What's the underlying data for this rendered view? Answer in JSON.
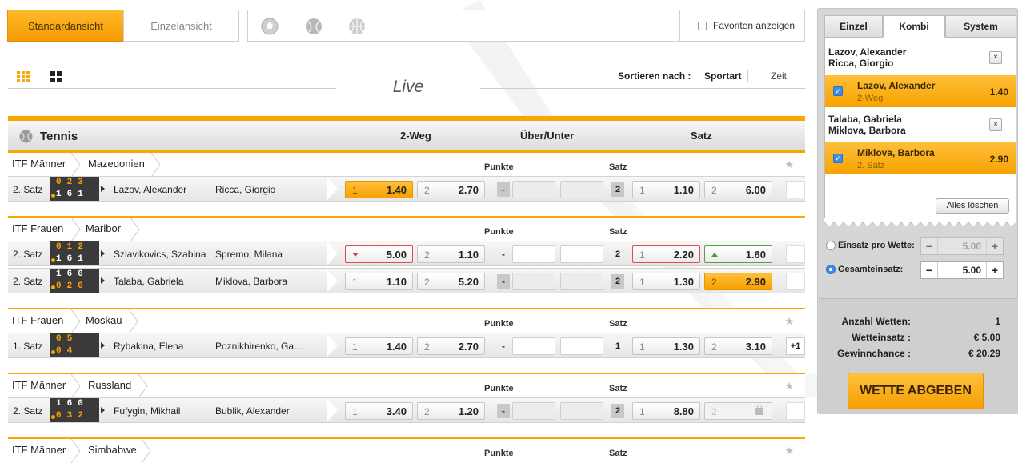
{
  "views": {
    "standard": "Standardansicht",
    "single": "Einzelansicht"
  },
  "favorites_label": "Favoriten anzeigen",
  "live_title": "Live",
  "sort": {
    "label": "Sortieren nach :",
    "sport": "Sportart",
    "time": "Zeit"
  },
  "sport": {
    "name": "Tennis",
    "col_2way": "2-Weg",
    "col_ou": "Über/Unter",
    "col_set": "Satz"
  },
  "sub_labels": {
    "points": "Punkte",
    "set": "Satz"
  },
  "leagues": [
    {
      "category": "ITF Männer",
      "event": "Mazedonien",
      "matches": [
        {
          "phase": "2. Satz",
          "score_top": "023",
          "score_bot": "161",
          "p1": "Lazov, Alexander",
          "p2": "Ricca, Giorgio",
          "o1_lbl": "1",
          "o1": "1.40",
          "o2_lbl": "2",
          "o2": "2.70",
          "dash": "-",
          "set_no": "2",
          "s1_lbl": "1",
          "s1": "1.10",
          "s2_lbl": "2",
          "s2": "6.00",
          "more": ""
        }
      ]
    },
    {
      "category": "ITF Frauen",
      "event": "Maribor",
      "matches": [
        {
          "phase": "2. Satz",
          "score_top": "012",
          "score_bot": "161",
          "p1": "Szlavikovics, Szabina",
          "p2": "Spremo, Milana",
          "o1_lbl": "",
          "o1": "5.00",
          "o2_lbl": "2",
          "o2": "1.10",
          "dash": "-",
          "set_no": "2",
          "s1_lbl": "1",
          "s1": "2.20",
          "s2_lbl": "",
          "s2": "1.60",
          "more": ""
        },
        {
          "phase": "2. Satz",
          "score_top": "160",
          "score_bot": "020",
          "p1": "Talaba, Gabriela",
          "p2": "Miklova, Barbora",
          "o1_lbl": "1",
          "o1": "1.10",
          "o2_lbl": "2",
          "o2": "5.20",
          "dash": "-",
          "set_no": "2",
          "s1_lbl": "1",
          "s1": "1.30",
          "s2_lbl": "2",
          "s2": "2.90",
          "more": ""
        }
      ]
    },
    {
      "category": "ITF Frauen",
      "event": "Moskau",
      "matches": [
        {
          "phase": "1. Satz",
          "score_top": "05",
          "score_bot": "04",
          "p1": "Rybakina, Elena",
          "p2": "Poznikhirenko, Ga…",
          "o1_lbl": "1",
          "o1": "1.40",
          "o2_lbl": "2",
          "o2": "2.70",
          "dash": "-",
          "set_no": "1",
          "s1_lbl": "1",
          "s1": "1.30",
          "s2_lbl": "2",
          "s2": "3.10",
          "more": "+1"
        }
      ]
    },
    {
      "category": "ITF Männer",
      "event": "Russland",
      "matches": [
        {
          "phase": "2. Satz",
          "score_top": "160",
          "score_bot": "032",
          "p1": "Fufygin, Mikhail",
          "p2": "Bublik, Alexander",
          "o1_lbl": "1",
          "o1": "3.40",
          "o2_lbl": "2",
          "o2": "1.20",
          "dash": "-",
          "set_no": "2",
          "s1_lbl": "1",
          "s1": "8.80",
          "s2_lbl": "2",
          "s2": "",
          "more": ""
        }
      ]
    },
    {
      "category": "ITF Männer",
      "event": "Simbabwe",
      "matches": []
    }
  ],
  "betslip": {
    "tabs": [
      "Einzel",
      "Kombi",
      "System"
    ],
    "selections": [
      {
        "event": "Lazov, Alexander\nRicca, Giorgio",
        "ev1": "Lazov, Alexander",
        "ev2": "Ricca, Giorgio",
        "pick": "Lazov, Alexander",
        "market": "2-Weg",
        "odd": "1.40"
      },
      {
        "event": "Talaba, Gabriela\nMiklova, Barbora",
        "ev1": "Talaba, Gabriela",
        "ev2": "Miklova, Barbora",
        "pick": "Miklova, Barbora",
        "market": "2. Satz",
        "odd": "2.90"
      }
    ],
    "remove_icon": "×",
    "clear_all": "Alles löschen",
    "stake_per_bet_label": "Einsatz pro Wette:",
    "stake_per_bet": "5.00",
    "total_stake_label": "Gesamteinsatz:",
    "total_stake": "5.00",
    "minus": "−",
    "plus": "+",
    "summary": {
      "count_label": "Anzahl Wetten:",
      "count": "1",
      "stake_label": "Wetteinsatz :",
      "stake": "€ 5.00",
      "win_label": "Gewinnchance :",
      "win": "€ 20.29"
    },
    "submit": "WETTE ABGEBEN"
  },
  "colors": {
    "accent": "#f7a700",
    "selected": "#f7a200",
    "down": "#e34b4b",
    "up": "#5aa042",
    "checkbox": "#3d8ee8"
  },
  "icons": [
    "grid-small-icon",
    "grid-large-icon",
    "soccer-icon",
    "tennis-icon",
    "basketball-icon",
    "star-icon",
    "close-icon",
    "lock-icon",
    "arrow-down-icon",
    "arrow-up-icon",
    "checkbox-icon"
  ]
}
